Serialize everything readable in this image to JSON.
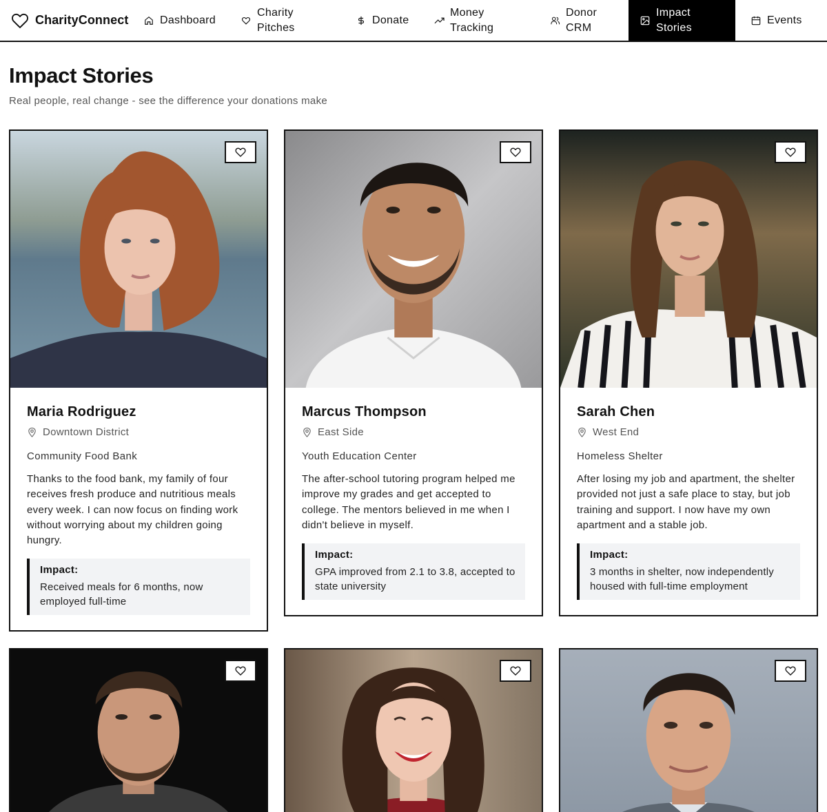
{
  "app": {
    "name": "CharityConnect"
  },
  "nav": {
    "items": [
      {
        "label": "Dashboard",
        "icon": "home-icon"
      },
      {
        "label": "Charity Pitches",
        "icon": "heart-icon"
      },
      {
        "label": "Donate",
        "icon": "dollar-icon"
      },
      {
        "label": "Money Tracking",
        "icon": "trending-up-icon"
      },
      {
        "label": "Donor CRM",
        "icon": "users-icon"
      },
      {
        "label": "Impact Stories",
        "icon": "image-icon",
        "active": true
      },
      {
        "label": "Events",
        "icon": "calendar-icon"
      }
    ]
  },
  "header": {
    "title": "Impact Stories",
    "subtitle": "Real people, real change - see the difference your donations make"
  },
  "stories": [
    {
      "name": "Maria Rodriguez",
      "location": "Downtown District",
      "organization": "Community Food Bank",
      "story": "Thanks to the food bank, my family of four receives fresh produce and nutritious meals every week. I can now focus on finding work without worrying about my children going hungry.",
      "impact_label": "Impact:",
      "impact": "Received meals for 6 months, now employed full-time"
    },
    {
      "name": "Marcus Thompson",
      "location": "East Side",
      "organization": "Youth Education Center",
      "story": "The after-school tutoring program helped me improve my grades and get accepted to college. The mentors believed in me when I didn't believe in myself.",
      "impact_label": "Impact:",
      "impact": "GPA improved from 2.1 to 3.8, accepted to state university"
    },
    {
      "name": "Sarah Chen",
      "location": "West End",
      "organization": "Homeless Shelter",
      "story": "After losing my job and apartment, the shelter provided not just a safe place to stay, but job training and support. I now have my own apartment and a stable job.",
      "impact_label": "Impact:",
      "impact": "3 months in shelter, now independently housed with full-time employment"
    }
  ],
  "colors": {
    "primary": "#111111",
    "active_nav_bg": "#000000",
    "impact_bg": "#f2f3f5",
    "muted_text": "#555555"
  }
}
